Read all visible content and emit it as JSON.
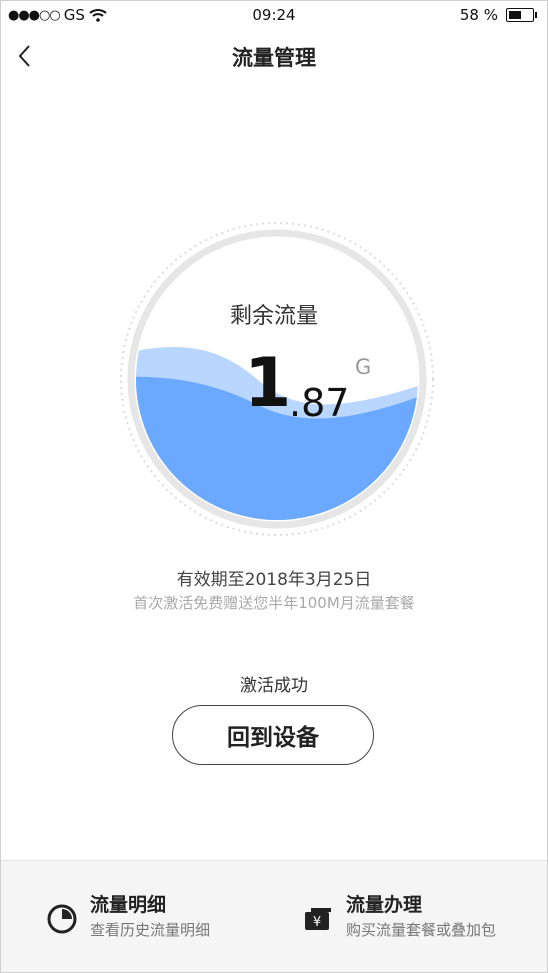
{
  "status_bar": {
    "signal": "●●●○○",
    "carrier": "GS",
    "time": "09:24",
    "battery_percent": "58 %",
    "battery_level": 0.58
  },
  "nav": {
    "title": "流量管理",
    "back_icon": "chevron-left-icon"
  },
  "gauge": {
    "label": "剩余流量",
    "value_int": "1",
    "value_dec": ".87",
    "unit": "G",
    "colors": {
      "wave_front": "#6aa9ff",
      "wave_back": "#b9d6ff",
      "ring": "#e6e6e6"
    }
  },
  "validity_text": "有效期至2018年3月25日",
  "promo_text": "首次激活免费赠送您半年100M月流量套餐",
  "activation_status": "激活成功",
  "return_button_label": "回到设备",
  "bottom_actions": [
    {
      "title": "流量明细",
      "subtitle": "查看历史流量明细",
      "icon": "pie-chart-icon"
    },
    {
      "title": "流量办理",
      "subtitle": "购买流量套餐或叠加包",
      "icon": "yen-wallet-icon"
    }
  ]
}
